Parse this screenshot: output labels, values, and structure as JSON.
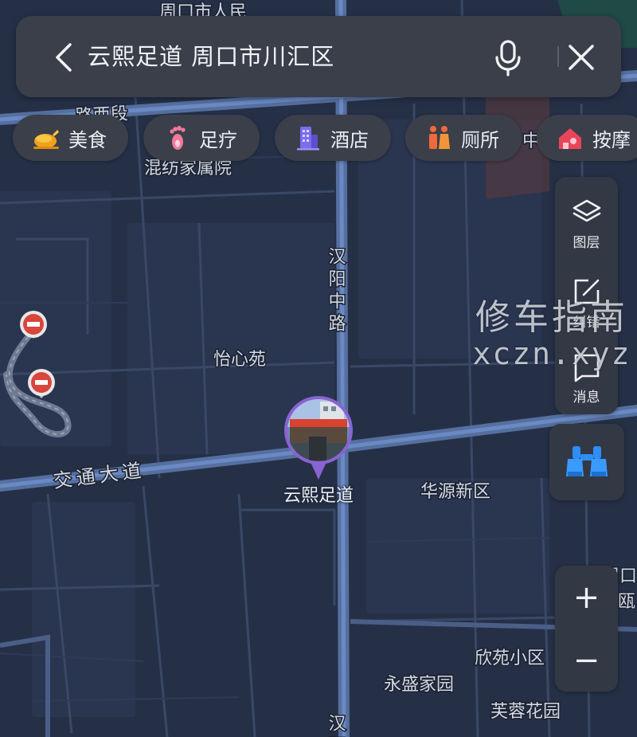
{
  "search": {
    "query": "云熙足道 周口市川汇区"
  },
  "categories": [
    {
      "label": "美食",
      "icon": "roast-chicken-icon"
    },
    {
      "label": "足疗",
      "icon": "footprint-icon"
    },
    {
      "label": "酒店",
      "icon": "hotel-building-icon"
    },
    {
      "label": "厕所",
      "icon": "restroom-icon"
    },
    {
      "label": "按摩",
      "icon": "massage-house-icon"
    }
  ],
  "tools": {
    "layers_label": "图层",
    "edit_label": "纠错",
    "messages_label": "消息"
  },
  "zoom": {
    "in_label": "+",
    "out_label": "−"
  },
  "watermark": {
    "title": "修车指南",
    "url": "xczn.xyz"
  },
  "selected_place": {
    "name": "云熙足道"
  },
  "map_labels": {
    "top_partial": "周口市人民",
    "top_left_road": "路西段",
    "compound": "混纺家属院",
    "road_hanyang": "汉阳中路",
    "community_yixin": "怡心苑",
    "road_jiaotong": "交通大道",
    "community_huayuan": "华源新区",
    "community_xinyuan": "欣苑小区",
    "community_yongsheng": "永盛家园",
    "community_furong": "芙蓉花园",
    "road_hanyang_bottom": "汉阳",
    "right_partial_1": "周口",
    "right_partial_2": "瓯",
    "right_partial_top": "中"
  },
  "colors": {
    "map_bg": "#253047",
    "road_major": "#5c77b8",
    "road_minor": "#3c4a68",
    "accent_blue": "#3a8df5",
    "pin_purple": "#8a63d2",
    "no_entry_red": "#d9463c"
  }
}
